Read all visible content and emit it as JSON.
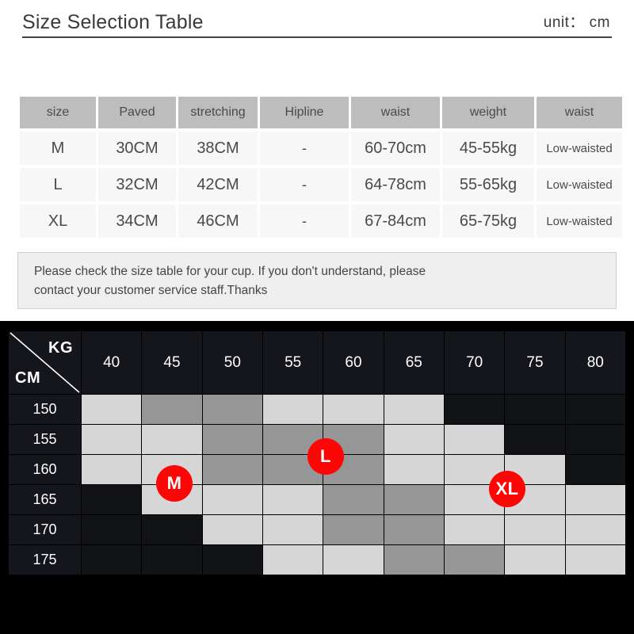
{
  "header": {
    "title": "Size Selection Table",
    "unit_label": "unit： cm"
  },
  "size_table": {
    "columns": [
      "size",
      "Paved",
      "stretching",
      "Hipline",
      "waist",
      "weight",
      "waist"
    ],
    "rows": [
      {
        "size": "M",
        "paved": "30CM",
        "stretching": "38CM",
        "hipline": "-",
        "waist": "60-70cm",
        "weight": "45-55kg",
        "waist_type": "Low-waisted"
      },
      {
        "size": "L",
        "paved": "32CM",
        "stretching": "42CM",
        "hipline": "-",
        "waist": "64-78cm",
        "weight": "55-65kg",
        "waist_type": "Low-waisted"
      },
      {
        "size": "XL",
        "paved": "34CM",
        "stretching": "46CM",
        "hipline": "-",
        "waist": "67-84cm",
        "weight": "65-75kg",
        "waist_type": "Low-waisted"
      }
    ]
  },
  "note": {
    "line1": "Please check the size table for your cup. If you don't understand, please",
    "line2": "contact your  customer service staff.Thanks"
  },
  "matrix": {
    "corner": {
      "kg": "KG",
      "cm": "CM"
    },
    "weight_columns": [
      "40",
      "45",
      "50",
      "55",
      "60",
      "65",
      "70",
      "75",
      "80"
    ],
    "height_rows": [
      "150",
      "155",
      "160",
      "165",
      "170",
      "175"
    ],
    "cells": [
      [
        "l",
        "g",
        "g",
        "l",
        "l",
        "l",
        "d",
        "d",
        "d"
      ],
      [
        "l",
        "l",
        "g",
        "g",
        "g",
        "l",
        "l",
        "d",
        "d"
      ],
      [
        "l",
        "l",
        "g",
        "g",
        "g",
        "l",
        "l",
        "l",
        "d"
      ],
      [
        "d",
        "l",
        "l",
        "l",
        "g",
        "g",
        "l",
        "l",
        "l"
      ],
      [
        "d",
        "d",
        "l",
        "l",
        "g",
        "g",
        "l",
        "l",
        "l"
      ],
      [
        "d",
        "d",
        "d",
        "l",
        "l",
        "g",
        "g",
        "l",
        "l"
      ]
    ],
    "badges": [
      {
        "id": "badge-m",
        "label": "M"
      },
      {
        "id": "badge-l",
        "label": "L"
      },
      {
        "id": "badge-xl",
        "label": "XL"
      }
    ],
    "legend": {
      "light_color": "#d6d6d6",
      "gray_color": "#969696",
      "empty_color": "#121317",
      "badge_color": "#fc0606"
    }
  }
}
